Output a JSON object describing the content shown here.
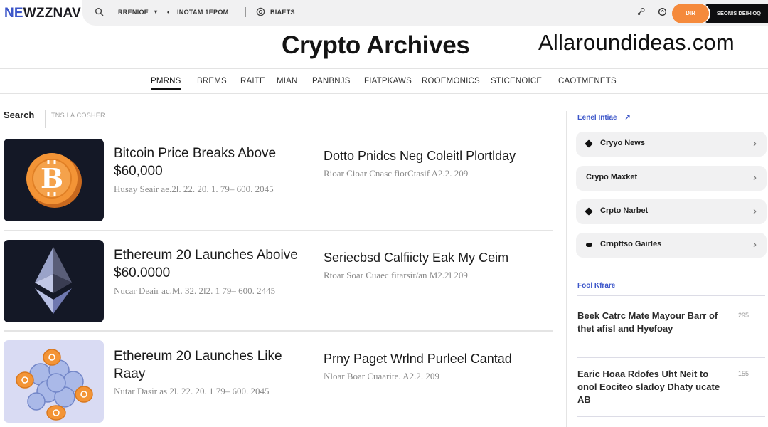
{
  "topbar": {
    "logo_accent": "NE",
    "logo_rest": "WZZNAV",
    "search_icon": "search-icon",
    "menu1_label": "RRENIOE",
    "menu1_caret": "▾",
    "menu2_bullet": "•",
    "menu2_label": "INOTAM 1EPOM",
    "menu3_icon": "at-icon",
    "menu3_label": "BIAETS",
    "key_icon": "key-icon",
    "shield_icon": "shield-icon",
    "orange_button_label": "DIR",
    "dark_button_label": "SEONIS DEIHIOQ"
  },
  "header": {
    "title": "Crypto Archives",
    "watermark": "Allaroundideas.com"
  },
  "categories": [
    {
      "label": "PMRNS",
      "active": true
    },
    {
      "label": "BREMS",
      "active": false
    },
    {
      "label": "RAITE",
      "active": false
    },
    {
      "label": "MIAN",
      "active": false
    },
    {
      "label": "PANBNJS",
      "active": false
    },
    {
      "label": "FIATPKAWS",
      "active": false
    },
    {
      "label": "ROOEMONICS",
      "active": false
    },
    {
      "label": "STICENOICE",
      "active": false
    },
    {
      "label": "CAOTMENETS",
      "active": false
    }
  ],
  "search": {
    "label": "Search",
    "placeholder": "TNS LA COSHER"
  },
  "articles": [
    {
      "title": "Bitcoin Price Breaks Above $60,000",
      "meta": "Husay Seair ae.2l. 22. 20. 1. 79– 600. 2045",
      "image": "bitcoin-coin",
      "side_title": "Dotto Pnidcs Neg Coleitl Plortlday",
      "side_meta": "Rioar Cioar Cnasc fiorCtasif A2.2. 209"
    },
    {
      "title": "Ethereum 20 Launches Aboive $60.0000",
      "meta": "Nucar Deair ac.M. 32. 2l2. 1 79– 600. 2445",
      "image": "ethereum-logo",
      "side_title": "Seriecbsd Calfiicty Eak My Ceim",
      "side_meta": "Rtoar Soar Cuaec fitarsir/an M2.2l 209"
    },
    {
      "title": "Ethereum 20 Launches Like Raay",
      "meta": "Nutar Dasir as 2l. 22. 20. 1 79– 600. 2045",
      "image": "coin-cluster",
      "side_title": "Prny Paget Wrlnd Purleel Cantad",
      "side_meta": "Nloar Boar Cuaarite. A2.2. 209"
    }
  ],
  "sidebar": {
    "section1_title": "Eenel Intiae",
    "section1_arrow": "↗",
    "items": [
      {
        "label": "Cryyo News",
        "bullet": true
      },
      {
        "label": "Crypo Maxket",
        "bullet": false
      },
      {
        "label": "Crpto Narbet",
        "bullet": true
      },
      {
        "label": "Crnpftso Gairles",
        "bullet": true
      }
    ],
    "chevron": "›",
    "section2_title": "Fool Kfrare",
    "popular": [
      {
        "title": "Beek Catrc Mate Mayour Barr of thet afisl and Hyefoay",
        "count": "295"
      },
      {
        "title": "Earic Hoaa Rdofes Uht Neit to onol Eociteo sladoy Dhaty ucate AB",
        "count": "155"
      }
    ]
  },
  "colors": {
    "accent_blue": "#3b55c9",
    "orange": "#f58a3c",
    "dark": "#0e0e10",
    "thumb_dark": "#141826",
    "thumb_light": "#d9dbf3"
  }
}
